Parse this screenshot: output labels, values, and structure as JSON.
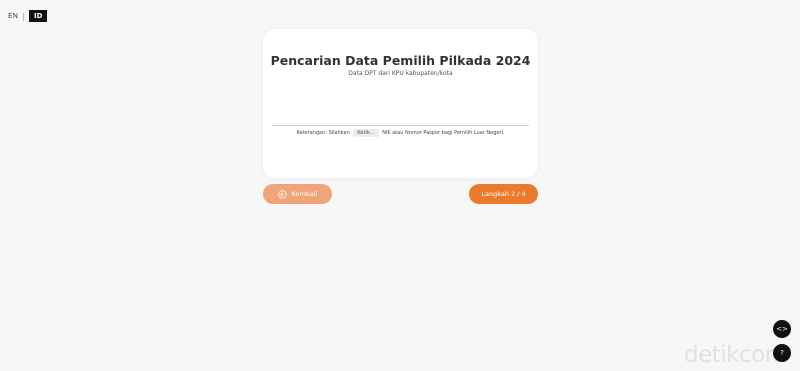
{
  "language": {
    "en_label": "EN",
    "separator": "|",
    "id_label": "ID"
  },
  "card": {
    "title": "Pencarian Data Pemilih Pilkada 2024",
    "subtitle": "Data DPT dari KPU kabupaten/kota",
    "note_prefix": "Keterangan: Silahkan",
    "note_chip": "Ketik...",
    "note_suffix": "NIK atau Nomor Paspor bagi Pemilih Luar Negeri."
  },
  "buttons": {
    "back_label": "Kembali",
    "next_label": "Langkah 2 / 4"
  },
  "fab": {
    "embed_glyph": "<>",
    "help_glyph": "?"
  },
  "watermark": {
    "text": "detikcom"
  },
  "colors": {
    "accent": "#ec7a2c",
    "accent_light": "#f0a47a",
    "background": "#f7f7f7"
  },
  "icons": {
    "back": "hand-back-icon",
    "embed": "code-icon",
    "help": "question-icon"
  }
}
